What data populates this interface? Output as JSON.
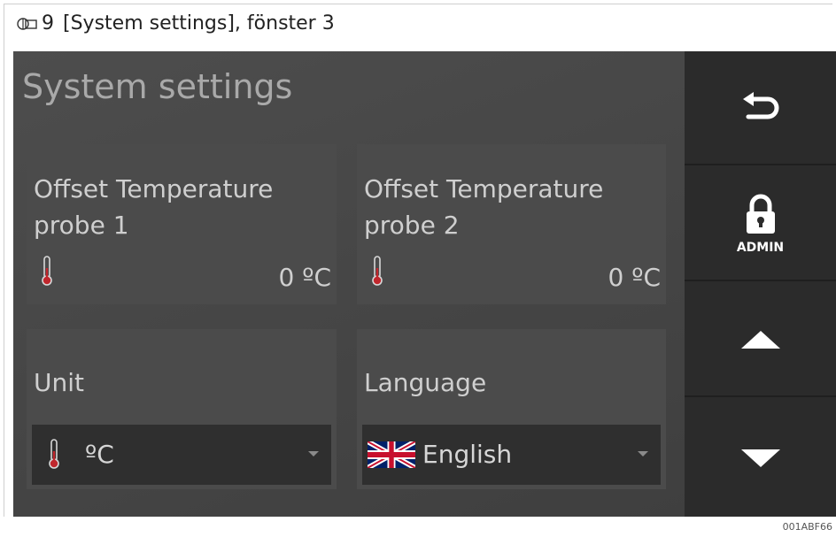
{
  "caption": {
    "prefix": "9",
    "text": "[System settings], fönster 3"
  },
  "page": {
    "title": "System settings"
  },
  "cards": {
    "probe1": {
      "title": "Offset Temperature probe 1",
      "value": "0 ºC",
      "icon": "thermometer-icon"
    },
    "probe2": {
      "title": "Offset Temperature probe 2",
      "value": "0 ºC",
      "icon": "thermometer-icon"
    },
    "unit": {
      "title": "Unit",
      "selected": "ºC",
      "icon": "thermometer-icon"
    },
    "language": {
      "title": "Language",
      "selected": "English",
      "icon": "uk-flag-icon"
    }
  },
  "sidebar": {
    "back": {
      "icon": "back-arrow-icon"
    },
    "admin": {
      "label": "ADMIN",
      "icon": "lock-icon"
    },
    "up": {
      "icon": "triangle-up-icon"
    },
    "down": {
      "icon": "triangle-down-icon"
    }
  },
  "footer": {
    "code": "001ABF66"
  },
  "colors": {
    "screen": "#464646",
    "card": "#4b4b4b",
    "sidebar": "#2b2b2b",
    "thermo_red": "#c0272d",
    "text": "#cfcfcf"
  }
}
